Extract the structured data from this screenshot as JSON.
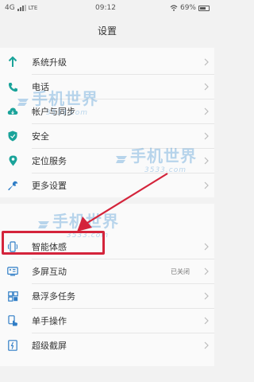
{
  "status_bar": {
    "carrier_left": "4G",
    "carrier_right": "LTE",
    "time": "09:12",
    "battery_percent": "69%",
    "battery_level": 0.69
  },
  "header": {
    "title": "设置"
  },
  "settings": [
    {
      "label": "系统升级",
      "icon": "arrow-up-icon",
      "color": "#1aa39a"
    },
    {
      "label": "电话",
      "icon": "phone-icon",
      "color": "#1aa39a"
    },
    {
      "label": "帐户与同步",
      "icon": "cloud-sync-icon",
      "color": "#1aa39a"
    },
    {
      "label": "安全",
      "icon": "shield-icon",
      "color": "#1aa39a"
    },
    {
      "label": "定位服务",
      "icon": "location-pin-icon",
      "color": "#1aa39a"
    },
    {
      "label": "更多设置",
      "icon": "wrench-icon",
      "color": "#2f7dc6"
    },
    {
      "label": "智能体感",
      "icon": "phone-motion-icon",
      "color": "#2f7dc6"
    },
    {
      "label": "多屏互动",
      "icon": "multi-screen-icon",
      "color": "#2f7dc6",
      "value": "已关闭"
    },
    {
      "label": "悬浮多任务",
      "icon": "floating-window-icon",
      "color": "#2f7dc6"
    },
    {
      "label": "单手操作",
      "icon": "one-hand-icon",
      "color": "#2f7dc6"
    },
    {
      "label": "超级截屏",
      "icon": "screenshot-icon",
      "color": "#2f7dc6"
    }
  ],
  "watermarks": [
    {
      "text": "手机世界",
      "sub": "3533.com"
    },
    {
      "text": "手机世界",
      "sub": "3533.com"
    },
    {
      "text": "手机世界",
      "sub": "3533.com"
    }
  ],
  "annotation": {
    "highlight_color": "#d4243b"
  }
}
